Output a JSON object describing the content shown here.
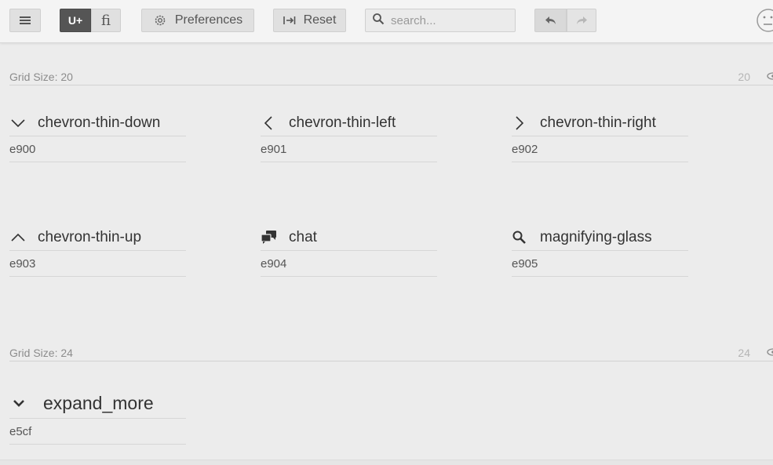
{
  "toolbar": {
    "menu_icon": "hamburger-icon",
    "unicode_label": "U+",
    "ligature_label": "ﬁ",
    "preferences_label": "Preferences",
    "preferences_icon": "gear-icon",
    "reset_label": "Reset",
    "reset_icon": "tab-arrow-icon",
    "search_placeholder": "search...",
    "undo_icon": "undo-icon",
    "redo_icon": "redo-icon",
    "avatar_icon": "neutral-face-icon"
  },
  "sections": [
    {
      "label": "Grid Size: 20",
      "size": "20",
      "glyphs": [
        {
          "name": "chevron-thin-down",
          "code": "e900",
          "icon": "chevron-thin-down-icon"
        },
        {
          "name": "chevron-thin-left",
          "code": "e901",
          "icon": "chevron-thin-left-icon"
        },
        {
          "name": "chevron-thin-right",
          "code": "e902",
          "icon": "chevron-thin-right-icon"
        },
        {
          "name": "chevron-thin-up",
          "code": "e903",
          "icon": "chevron-thin-up-icon"
        },
        {
          "name": "chat",
          "code": "e904",
          "icon": "chat-icon"
        },
        {
          "name": "magnifying-glass",
          "code": "e905",
          "icon": "magnifying-glass-icon"
        }
      ]
    },
    {
      "label": "Grid Size: 24",
      "size": "24",
      "glyphs": [
        {
          "name": "expand_more",
          "code": "e5cf",
          "icon": "expand-more-icon"
        }
      ]
    }
  ],
  "glyph_char": "",
  "colors": {
    "background": "#ececec",
    "toolbar": "#f4f4f4",
    "active_button": "#555555",
    "text": "#333333",
    "muted": "#8c8c8c"
  }
}
